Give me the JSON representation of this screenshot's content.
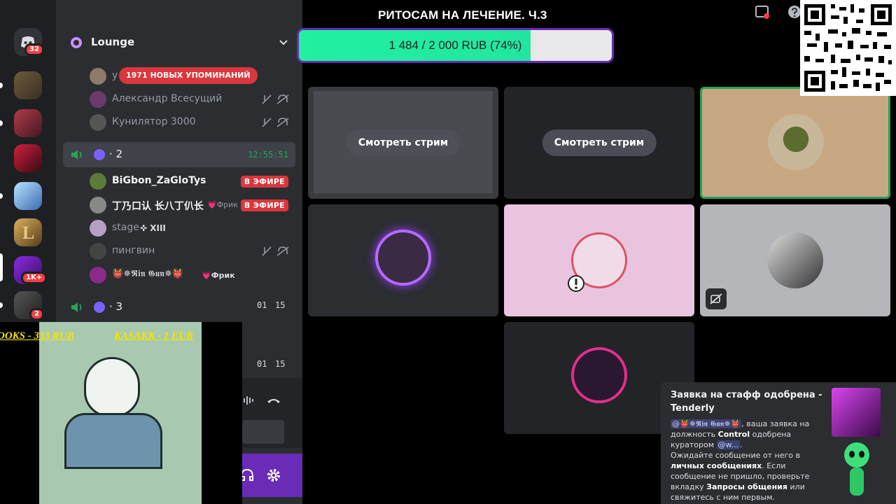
{
  "rail": {
    "home_badge": "32",
    "server_badges": [
      "1K+",
      "2"
    ]
  },
  "sidebar": {
    "server_name": "Lounge",
    "mentions_pill": "1971 НОВЫХ УПОМИНАНИЙ",
    "members_top": [
      {
        "name": "y"
      },
      {
        "name": "Александр Всесущий"
      },
      {
        "name": "Кунилятор 3000"
      }
    ],
    "voice_channels": [
      {
        "label": "· 2",
        "timer": "12:55:51"
      },
      {
        "label": "· 3",
        "timer_a": "01",
        "timer_b": "15"
      },
      {
        "timer_a": "01",
        "timer_b": "15"
      }
    ],
    "members_vc2": [
      {
        "name": "BiGbon_ZaGloTys",
        "badge": "В ЭФИРЕ"
      },
      {
        "name": "丁乃口认 长八丁仈长",
        "tag": "Фрик",
        "badge": "В ЭФИРЕ"
      },
      {
        "name": "stage",
        "tag": "✜ XIII"
      },
      {
        "name": "пингвин"
      },
      {
        "name": "👹✵𝕽𝖎𝖓 𝕲𝖚𝖓✵👹",
        "tag": "Фрик"
      }
    ]
  },
  "stream": {
    "donation_title": "РИТОСАМ НА ЛЕЧЕНИЕ. Ч.3",
    "donation_amount": "1 484 / 2 000 RUB (74%)",
    "donation_progress": 0.74,
    "ticker": [
      "OOKS - 333 RUB",
      "KASAKK - 1 EUR"
    ]
  },
  "grid": {
    "watch_stream_label": "Смотреть стрим"
  },
  "notification": {
    "title": "Заявка на стафф одобрена - Tenderly",
    "mention_user": "@👹✵𝕽𝖎𝖓 𝕲𝖚𝖓✵👹",
    "line1_rest": ", ваша заявка на должность ",
    "role": "Control",
    "line1_end": " одобрена куратором",
    "mention_curator": "@w...",
    "line2_a": "Ожидайте сообщение от него в ",
    "line2_b": "личных сообщениях",
    "line2_c": ". Если сообщение не пришло, проверьте вкладку ",
    "line2_d": "Запросы общения",
    "line2_e": " или свяжитесь с ним первым."
  },
  "colors": {
    "accent": "#5865f2",
    "live_red": "#da373c",
    "progress_green": "#20f0a0",
    "progress_border": "#6a2bb6",
    "speaking_green": "#23a55a"
  }
}
